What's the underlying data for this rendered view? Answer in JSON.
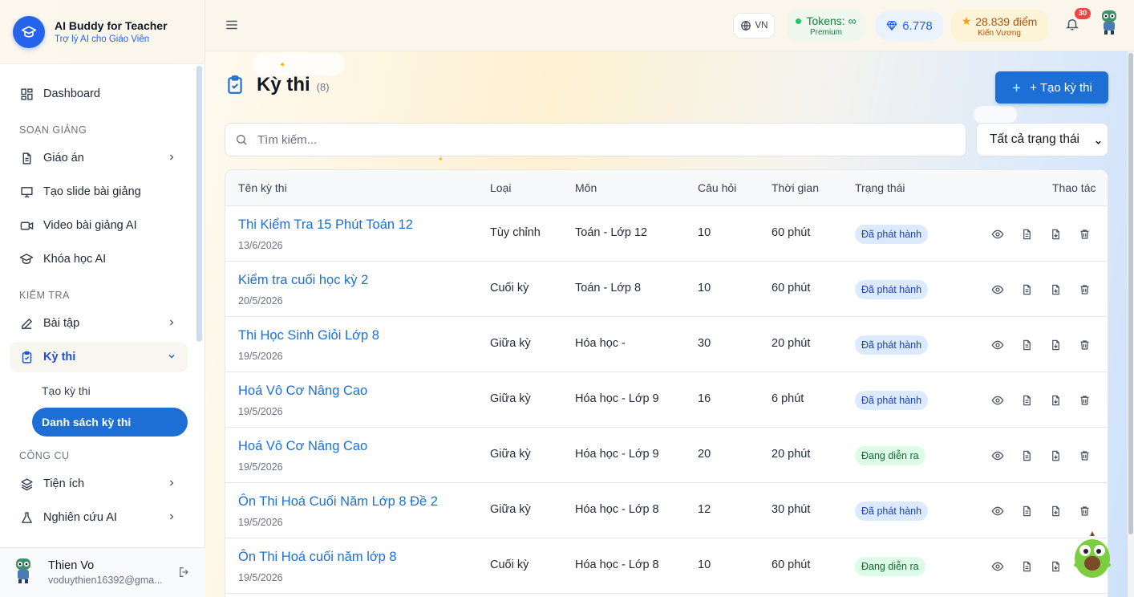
{
  "brand": {
    "title": "AI Buddy for Teacher",
    "subtitle": "Trợ lý AI cho Giáo Viên"
  },
  "sidebar": {
    "dashboard": "Dashboard",
    "section_soan_giang": "SOẠN GIẢNG",
    "giao_an": "Giáo án",
    "tao_slide": "Tạo slide bài giảng",
    "video": "Video bài giảng AI",
    "khoa_hoc": "Khóa học AI",
    "section_kiem_tra": "KIỂM TRA",
    "bai_tap": "Bài tập",
    "ky_thi": "Kỳ thi",
    "tao_ky_thi": "Tạo kỳ thi",
    "danh_sach_ky_thi": "Danh sách kỳ thi",
    "section_cong_cu": "CÔNG CỤ",
    "tien_ich": "Tiện ích",
    "nghien_cuu": "Nghiên cứu AI"
  },
  "user": {
    "name": "Thien Vo",
    "email": "voduythien16392@gma..."
  },
  "header": {
    "lang": "VN",
    "tokens_label": "Tokens: ∞",
    "tokens_sub": "Premium",
    "gems": "6.778",
    "points": "28.839 điểm",
    "points_sub": "Kiến Vương",
    "notifications": "30"
  },
  "page": {
    "title": "Kỳ thi",
    "count": "(8)",
    "create_label": "+ Tạo kỳ thi",
    "search_placeholder": "Tìm kiếm...",
    "status_filter": "Tất cả trạng thái"
  },
  "table": {
    "headers": {
      "name": "Tên kỳ thi",
      "type": "Loại",
      "subject": "Môn",
      "questions": "Câu hỏi",
      "duration": "Thời gian",
      "status": "Trạng thái",
      "actions": "Thao tác"
    },
    "rows": [
      {
        "name": "Thi Kiểm Tra 15 Phút Toán 12",
        "date": "13/6/2026",
        "type": "Tùy chỉnh",
        "subject": "Toán - Lớp 12",
        "questions": "10",
        "duration": "60 phút",
        "status": "Đã phát hành"
      },
      {
        "name": "Kiểm tra cuối học kỳ 2",
        "date": "20/5/2026",
        "type": "Cuối kỳ",
        "subject": "Toán - Lớp 8",
        "questions": "10",
        "duration": "60 phút",
        "status": "Đã phát hành"
      },
      {
        "name": "Thi Học Sinh Giỏi Lớp 8",
        "date": "19/5/2026",
        "type": "Giữa kỳ",
        "subject": "Hóa học -",
        "questions": "30",
        "duration": "20 phút",
        "status": "Đã phát hành"
      },
      {
        "name": "Hoá Vô Cơ Nâng Cao",
        "date": "19/5/2026",
        "type": "Giữa kỳ",
        "subject": "Hóa học - Lớp 9",
        "questions": "16",
        "duration": "6 phút",
        "status": "Đã phát hành"
      },
      {
        "name": "Hoá Vô Cơ Nâng Cao",
        "date": "19/5/2026",
        "type": "Giữa kỳ",
        "subject": "Hóa học - Lớp 9",
        "questions": "20",
        "duration": "20 phút",
        "status": "Đang diễn ra"
      },
      {
        "name": "Ôn Thi Hoá Cuối Năm Lớp 8 Đề 2",
        "date": "19/5/2026",
        "type": "Giữa kỳ",
        "subject": "Hóa học - Lớp 8",
        "questions": "12",
        "duration": "30 phút",
        "status": "Đã phát hành"
      },
      {
        "name": "Ôn Thi Hoá cuối năm lớp 8",
        "date": "19/5/2026",
        "type": "Cuối kỳ",
        "subject": "Hóa học - Lớp 8",
        "questions": "10",
        "duration": "60 phút",
        "status": "Đang diễn ra"
      }
    ]
  },
  "colors": {
    "accent": "#1d6fd6",
    "published_bg": "#dbeafe",
    "live_bg": "#dcfce7"
  }
}
